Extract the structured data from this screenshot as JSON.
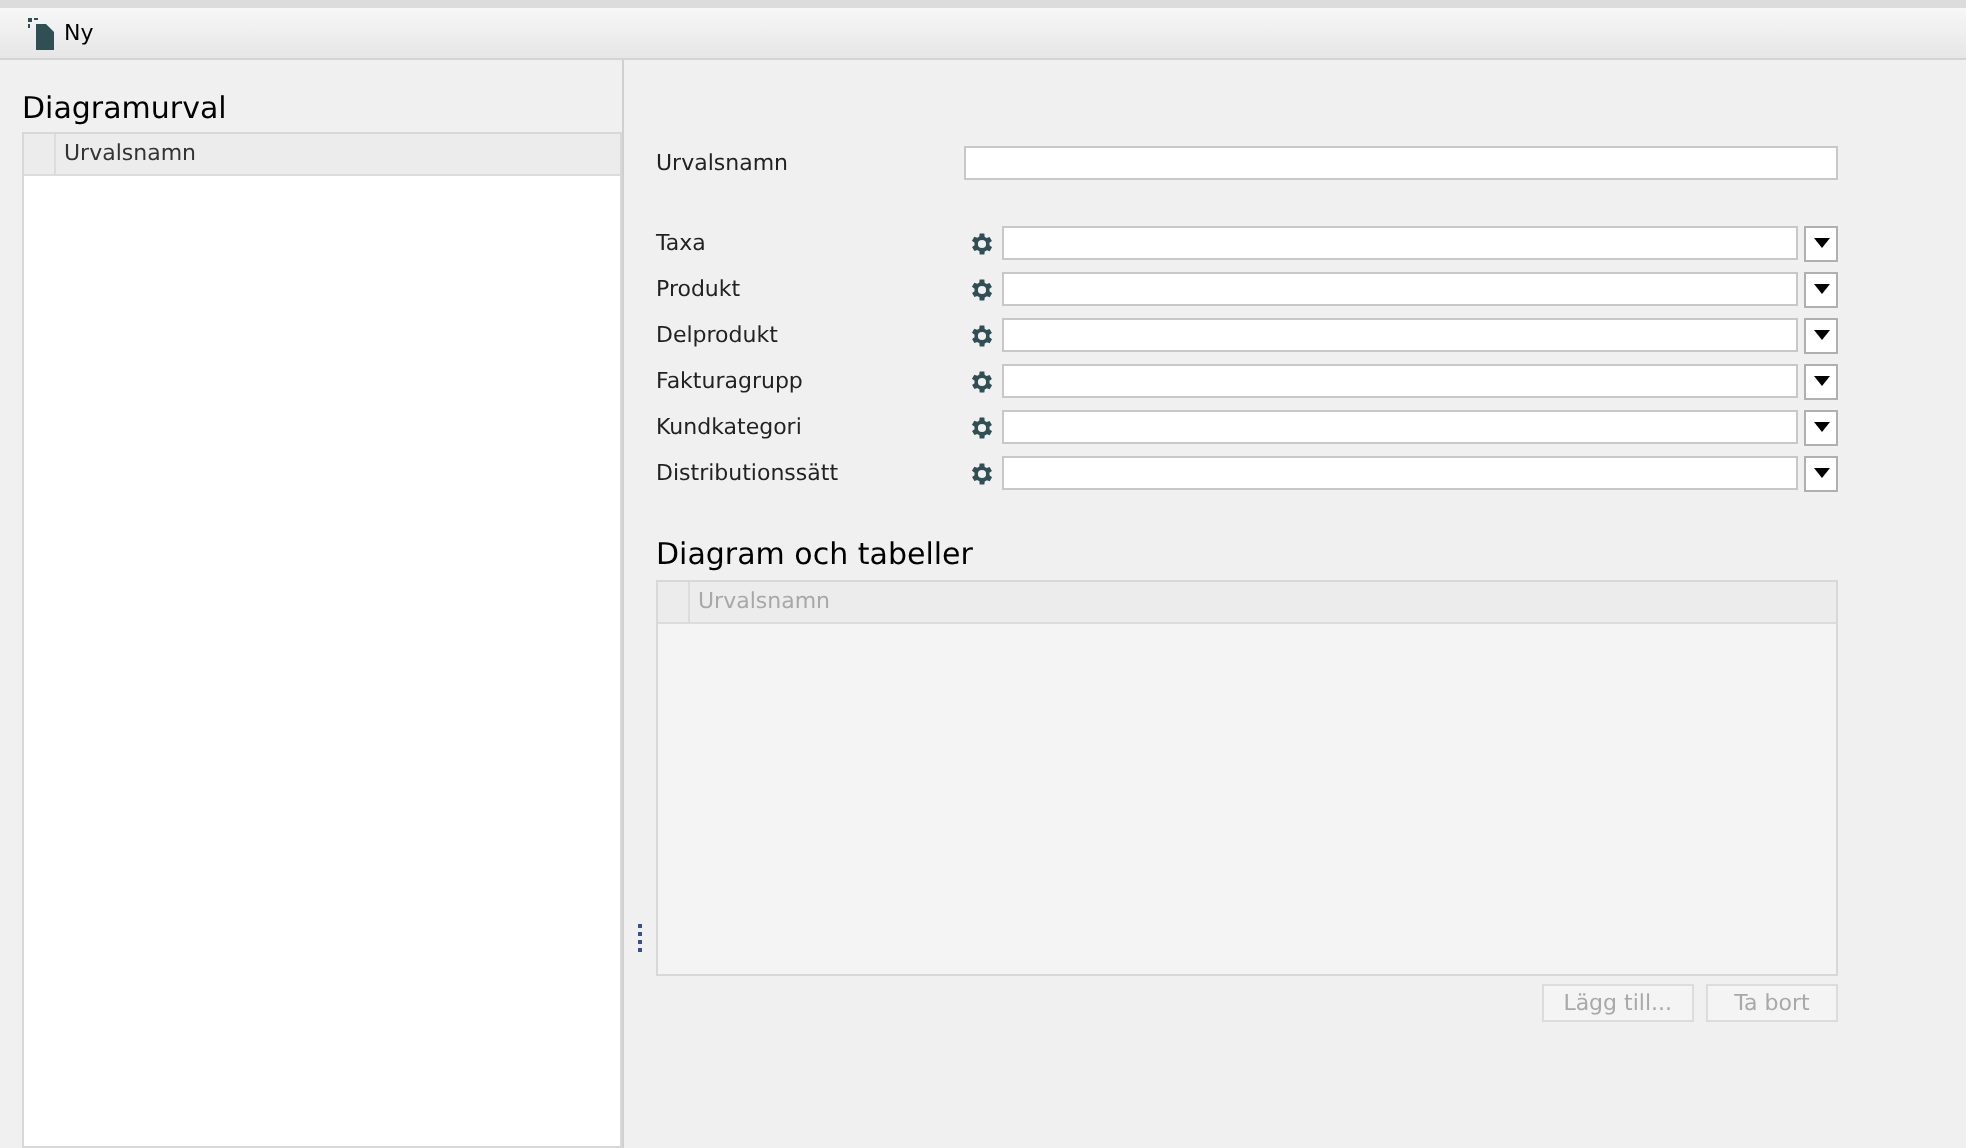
{
  "toolbar": {
    "new_button": "Ny"
  },
  "selection_list": {
    "title": "Diagramurval",
    "columns": [
      "Urvalsnamn"
    ]
  },
  "form": {
    "name_label": "Urvalsnamn",
    "filters": [
      {
        "label": "Taxa"
      },
      {
        "label": "Produkt"
      },
      {
        "label": "Delprodukt"
      },
      {
        "label": "Fakturagrupp"
      },
      {
        "label": "Kundkategori"
      },
      {
        "label": "Distributionssätt"
      }
    ]
  },
  "charts_section": {
    "title": "Diagram och tabeller",
    "disabled": true,
    "columns": [
      "Urvalsnamn"
    ],
    "buttons": [
      {
        "label": "Lägg till...",
        "disabled": true
      },
      {
        "label": "Ta bort",
        "disabled": true
      }
    ]
  }
}
